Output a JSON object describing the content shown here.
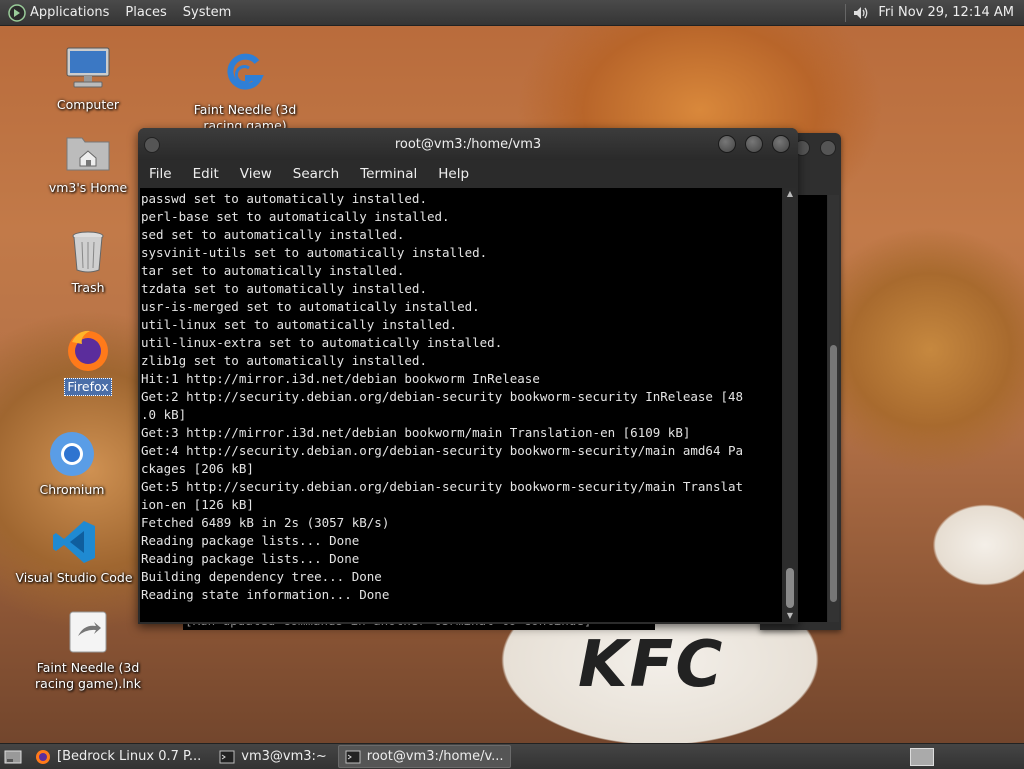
{
  "top_panel": {
    "menus": [
      "Applications",
      "Places",
      "System"
    ],
    "clock": "Fri Nov 29, 12:14 AM"
  },
  "desktop": {
    "icons": [
      {
        "label": "Computer",
        "icon": "computer-icon"
      },
      {
        "label": "Faint Needle (3d racing game)",
        "icon": "game-g-icon"
      },
      {
        "label": "vm3's Home",
        "icon": "home-folder-icon"
      },
      {
        "label": "Trash",
        "icon": "trash-icon"
      },
      {
        "label": "Firefox",
        "icon": "firefox-icon"
      },
      {
        "label": "Chromium",
        "icon": "chromium-icon"
      },
      {
        "label": "Visual Studio Code",
        "icon": "vscode-icon"
      },
      {
        "label": "Faint Needle (3d racing game).lnk",
        "icon": "shortcut-icon"
      }
    ],
    "wallpaper_text": "KFC"
  },
  "terminal": {
    "title": "root@vm3:/home/vm3",
    "menu": [
      "File",
      "Edit",
      "View",
      "Search",
      "Terminal",
      "Help"
    ],
    "lines": [
      "passwd set to automatically installed.",
      "perl-base set to automatically installed.",
      "sed set to automatically installed.",
      "sysvinit-utils set to automatically installed.",
      "tar set to automatically installed.",
      "tzdata set to automatically installed.",
      "usr-is-merged set to automatically installed.",
      "util-linux set to automatically installed.",
      "util-linux-extra set to automatically installed.",
      "zlib1g set to automatically installed.",
      "Hit:1 http://mirror.i3d.net/debian bookworm InRelease",
      "Get:2 http://security.debian.org/debian-security bookworm-security InRelease [48",
      ".0 kB]",
      "Get:3 http://mirror.i3d.net/debian bookworm/main Translation-en [6109 kB]",
      "Get:4 http://security.debian.org/debian-security bookworm-security/main amd64 Pa",
      "ckages [206 kB]",
      "Get:5 http://security.debian.org/debian-security bookworm-security/main Translat",
      "ion-en [126 kB]",
      "Fetched 6489 kB in 2s (3057 kB/s)",
      "Reading package lists... Done",
      "Reading package lists... Done",
      "Building dependency tree... Done",
      "Reading state information... Done"
    ]
  },
  "back_terminal": {
    "visible_text": "[Run updated commands in another terminal to continue]"
  },
  "taskbar": {
    "tasks": [
      {
        "label": "[Bedrock Linux 0.7 P...",
        "icon": "firefox-icon",
        "active": false
      },
      {
        "label": "vm3@vm3:~",
        "icon": "terminal-icon",
        "active": false
      },
      {
        "label": "root@vm3:/home/v...",
        "icon": "terminal-icon",
        "active": true
      }
    ]
  }
}
